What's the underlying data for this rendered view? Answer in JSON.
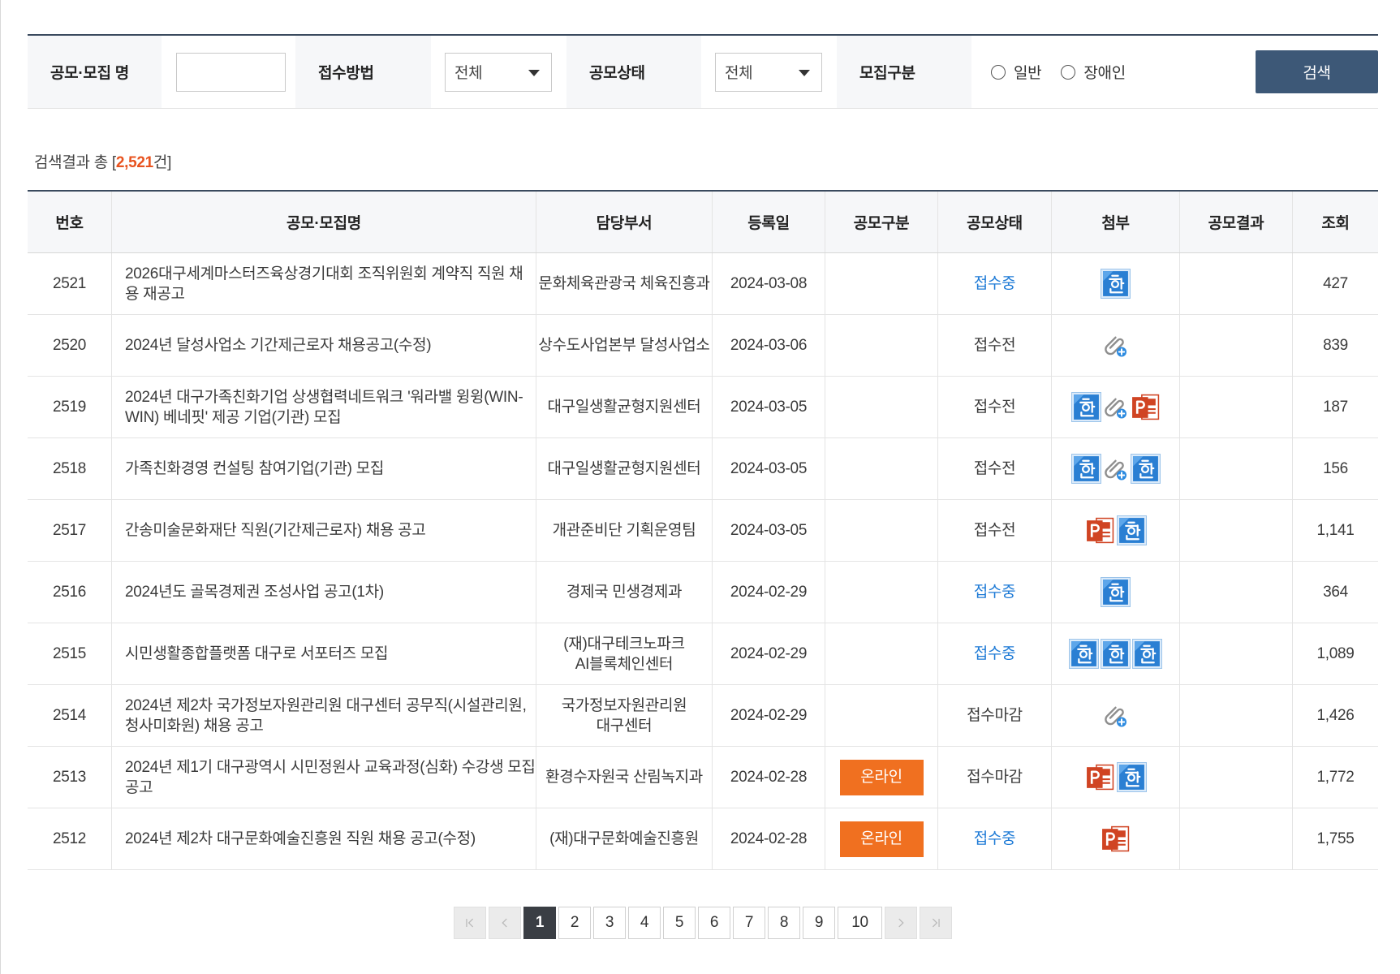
{
  "search": {
    "title_label": "공모·모집 명",
    "title_value": "",
    "method_label": "접수방법",
    "method_value": "전체",
    "status_label": "공모상태",
    "status_value": "전체",
    "category_label": "모집구분",
    "category_options": [
      "일반",
      "장애인"
    ],
    "button_label": "검색"
  },
  "result": {
    "prefix": "검색결과 총 [",
    "count": "2,521",
    "suffix": "건]"
  },
  "table": {
    "headers": {
      "no": "번호",
      "title": "공모·모집명",
      "dept": "담당부서",
      "date": "등록일",
      "type": "공모구분",
      "status": "공모상태",
      "attachments": "첨부",
      "result": "공모결과",
      "views": "조회"
    },
    "rows": [
      {
        "no": "2521",
        "title": "2026대구세계마스터즈육상경기대회 조직위원회 계약직 직원 채용 재공고",
        "dept": "문화체육관광국 체육진흥과",
        "date": "2024-03-08",
        "type": "",
        "status": "접수중",
        "status_color": "#1d7ad6",
        "attachments": [
          "hwp-file-icon"
        ],
        "result": "",
        "views": "427"
      },
      {
        "no": "2520",
        "title": "2024년 달성사업소 기간제근로자 채용공고(수정)",
        "dept": "상수도사업본부 달성사업소",
        "date": "2024-03-06",
        "type": "",
        "status": "접수전",
        "status_color": "#3a3a3a",
        "attachments": [
          "attachment-clip-icon"
        ],
        "result": "",
        "views": "839"
      },
      {
        "no": "2519",
        "title": "2024년 대구가족친화기업 상생협력네트워크 '워라밸 윙윙(WIN-WIN) 베네핏' 제공 기업(기관) 모집",
        "dept": "대구일생활균형지원센터",
        "date": "2024-03-05",
        "type": "",
        "status": "접수전",
        "status_color": "#3a3a3a",
        "attachments": [
          "hwp-file-icon",
          "attachment-clip-icon",
          "ppt-file-icon"
        ],
        "result": "",
        "views": "187"
      },
      {
        "no": "2518",
        "title": "가족친화경영 컨설팅 참여기업(기관) 모집",
        "dept": "대구일생활균형지원센터",
        "date": "2024-03-05",
        "type": "",
        "status": "접수전",
        "status_color": "#3a3a3a",
        "attachments": [
          "hwp-file-icon",
          "attachment-clip-icon",
          "hwp-file-icon"
        ],
        "result": "",
        "views": "156"
      },
      {
        "no": "2517",
        "title": "간송미술문화재단 직원(기간제근로자) 채용 공고",
        "dept": "개관준비단 기획운영팀",
        "date": "2024-03-05",
        "type": "",
        "status": "접수전",
        "status_color": "#3a3a3a",
        "attachments": [
          "ppt-file-icon",
          "hwp-file-icon"
        ],
        "result": "",
        "views": "1,141"
      },
      {
        "no": "2516",
        "title": "2024년도 골목경제권 조성사업 공고(1차)",
        "dept": "경제국 민생경제과",
        "date": "2024-02-29",
        "type": "",
        "status": "접수중",
        "status_color": "#1d7ad6",
        "attachments": [
          "hwp-file-icon"
        ],
        "result": "",
        "views": "364"
      },
      {
        "no": "2515",
        "title": "시민생활종합플랫폼 대구로 서포터즈 모집",
        "dept": "(재)대구테크노파크 AI블록체인센터",
        "date": "2024-02-29",
        "type": "",
        "status": "접수중",
        "status_color": "#1d7ad6",
        "attachments": [
          "hwp-file-icon",
          "hwp-file-icon",
          "hwp-file-icon"
        ],
        "result": "",
        "views": "1,089"
      },
      {
        "no": "2514",
        "title": "2024년 제2차 국가정보자원관리원 대구센터 공무직(시설관리원, 청사미화원) 채용 공고",
        "dept": "국가정보자원관리원 대구센터",
        "date": "2024-02-29",
        "type": "",
        "status": "접수마감",
        "status_color": "#3a3a3a",
        "attachments": [
          "attachment-clip-icon"
        ],
        "result": "",
        "views": "1,426"
      },
      {
        "no": "2513",
        "title": "2024년 제1기 대구광역시 시민정원사 교육과정(심화) 수강생 모집 공고",
        "dept": "환경수자원국 산림녹지과",
        "date": "2024-02-28",
        "type": "온라인",
        "status": "접수마감",
        "status_color": "#3a3a3a",
        "attachments": [
          "ppt-file-icon",
          "hwp-file-icon"
        ],
        "result": "",
        "views": "1,772"
      },
      {
        "no": "2512",
        "title": "2024년 제2차 대구문화예술진흥원 직원 채용 공고(수정)",
        "dept": "(재)대구문화예술진흥원",
        "date": "2024-02-28",
        "type": "온라인",
        "status": "접수중",
        "status_color": "#1d7ad6",
        "attachments": [
          "ppt-file-icon"
        ],
        "result": "",
        "views": "1,755"
      }
    ]
  },
  "pagination": {
    "pages": [
      "1",
      "2",
      "3",
      "4",
      "5",
      "6",
      "7",
      "8",
      "9",
      "10"
    ],
    "current": "1"
  },
  "colors": {
    "accent_navy": "#3a4a5e",
    "search_button": "#3d5877",
    "result_count": "#e8531f",
    "status_open": "#1d7ad6",
    "online_badge": "#f07020",
    "page_active": "#3a3e44"
  }
}
